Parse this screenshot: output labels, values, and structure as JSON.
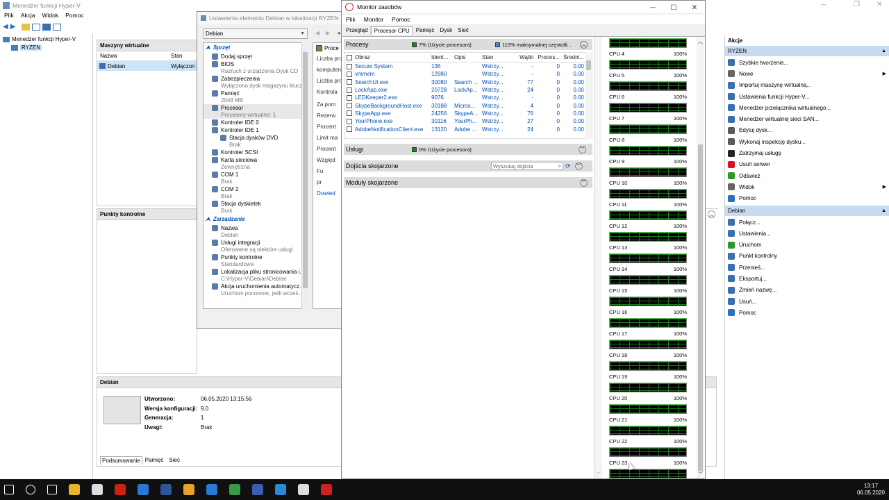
{
  "hyperv": {
    "title": "Menedżer funkcji Hyper-V",
    "menu": [
      "Plik",
      "Akcja",
      "Widok",
      "Pomoc"
    ],
    "tree_root": "Menedżer funkcji Hyper-V",
    "tree_host": "RYZEN",
    "vm_panel_title": "Maszyny wirtualne",
    "vm_cols": [
      "Nazwa",
      "Stan"
    ],
    "vm_rows": [
      {
        "name": "Debian",
        "state": "Wyłączon"
      }
    ],
    "checkpoints_title": "Punkty kontrolne",
    "details_title": "Debian",
    "details": [
      {
        "label": "Utworzono:",
        "value": "06.05.2020 13:15:56"
      },
      {
        "label": "Wersja konfiguracji:",
        "value": "9.0"
      },
      {
        "label": "Generacja:",
        "value": "1"
      },
      {
        "label": "Uwagi:",
        "value": "Brak"
      }
    ],
    "details_tabs": [
      "Podsumowanie",
      "Pamięć",
      "Sieć"
    ],
    "actions_title": "Akcje",
    "actions_host": "RYZEN",
    "host_actions": [
      "Szybkie tworzenie...",
      "Nowe",
      "Importuj maszynę wirtualną...",
      "Ustawienia funkcji Hyper-V...",
      "Menedżer przełącznika wirtualnego...",
      "Menedżer wirtualnej sieci SAN...",
      "Edytuj dysk...",
      "Wykonaj inspekcję dysku...",
      "Zatrzymaj usługę",
      "Usuń serwer",
      "Odśwież",
      "Widok",
      "Pomoc"
    ],
    "actions_vm": "Debian",
    "vm_actions": [
      "Połącz...",
      "Ustawienia...",
      "Uruchom",
      "Punkt kontrolny",
      "Przenieś...",
      "Eksportuj...",
      "Zmień nazwę...",
      "Usuń...",
      "Pomoc"
    ]
  },
  "settings": {
    "title": "Ustawienia elementu Debian w lokalizacji RYZEN",
    "vm_select": "Debian",
    "hw_header": "Sprzęt",
    "hw_items": [
      {
        "name": "Dodaj sprzęt",
        "sub": ""
      },
      {
        "name": "BIOS",
        "sub": "Rozruch z urządzenia Dysk CD"
      },
      {
        "name": "Zabezpieczenia",
        "sub": "Wyłączono dysk magazynu kluczy"
      },
      {
        "name": "Pamięć",
        "sub": "2048 MB"
      },
      {
        "name": "Procesor",
        "sub": "Procesory wirtualne: 1"
      },
      {
        "name": "Kontroler IDE 0",
        "sub": ""
      },
      {
        "name": "Kontroler IDE 1",
        "sub": ""
      },
      {
        "name": "Stacja dysków DVD",
        "sub": "Brak"
      },
      {
        "name": "Kontroler SCSI",
        "sub": ""
      },
      {
        "name": "Karta sieciowa",
        "sub": "Zewnętrzna"
      },
      {
        "name": "COM 1",
        "sub": "Brak"
      },
      {
        "name": "COM 2",
        "sub": "Brak"
      },
      {
        "name": "Stacja dyskietek",
        "sub": "Brak"
      }
    ],
    "mgmt_header": "Zarządzanie",
    "mgmt_items": [
      {
        "name": "Nazwa",
        "sub": "Debian"
      },
      {
        "name": "Usługi integracji",
        "sub": "Oferowane są niektóre usługi"
      },
      {
        "name": "Punkty kontrolne",
        "sub": "Standardowa"
      },
      {
        "name": "Lokalizacja pliku stronicowania i...",
        "sub": "C:\\Hyper-V\\Debian\\Debian"
      },
      {
        "name": "Akcja uruchomienia automatycz...",
        "sub": "Uruchom ponownie, jeśli wcześ..."
      }
    ],
    "right_title": "Proce",
    "right_lines": [
      "Liczba pro",
      "komputera",
      "Liczba pro",
      "Kontrola",
      "Za pom",
      "Rezerw",
      "Procent",
      "Limit ma",
      "Procent",
      "Względ",
      "Fu",
      "pr",
      "Dowied"
    ]
  },
  "resmon": {
    "title": "Monitor zasobów",
    "menu": [
      "Plik",
      "Monitor",
      "Pomoc"
    ],
    "tabs": [
      "Przegląd",
      "Procesor CPU",
      "Pamięć",
      "Dysk",
      "Sieć"
    ],
    "processes_title": "Procesy",
    "processes_usage": "7% (Użycie procesora)",
    "processes_freq": "110% maksymalnej częstotli...",
    "proc_cols": [
      "Obraz",
      "Ident...",
      "Opis",
      "Stan",
      "Wątki",
      "Proces...",
      "Średni..."
    ],
    "proc_rows": [
      [
        "Secure System",
        "136",
        "",
        "Wstrzy...",
        "-",
        "0",
        "0.00"
      ],
      [
        "vmmem",
        "12980",
        "",
        "Wstrzy...",
        "-",
        "0",
        "0.00"
      ],
      [
        "SearchUI.exe",
        "30080",
        "Search ...",
        "Wstrzy...",
        "77",
        "0",
        "0.00"
      ],
      [
        "LockApp.exe",
        "20728",
        "LockAp...",
        "Wstrzy...",
        "24",
        "0",
        "0.00"
      ],
      [
        "LEDKeeper2.exe",
        "9076",
        "",
        "Wstrzy...",
        "-",
        "0",
        "0.00"
      ],
      [
        "SkypeBackgroundHost.exe",
        "30188",
        "Micros...",
        "Wstrzy...",
        "4",
        "0",
        "0.00"
      ],
      [
        "SkypeApp.exe",
        "24256",
        "SkypeA...",
        "Wstrzy...",
        "76",
        "0",
        "0.00"
      ],
      [
        "YourPhone.exe",
        "30116",
        "YourPh...",
        "Wstrzy...",
        "27",
        "0",
        "0.00"
      ],
      [
        "AdobeNotificationClient.exe",
        "13120",
        "Adobe ...",
        "Wstrzy...",
        "24",
        "0",
        "0.00"
      ]
    ],
    "services_title": "Usługi",
    "services_usage": "0% (Użycie procesora)",
    "handles_title": "Dojścia skojarzone",
    "handles_search_placeholder": "Wyszukaj dojścia",
    "modules_title": "Moduły skojarzone",
    "cpus": [
      {
        "label": "CPU 4",
        "value": "100%"
      },
      {
        "label": "CPU 5",
        "value": "100%"
      },
      {
        "label": "CPU 6",
        "value": "100%"
      },
      {
        "label": "CPU 7",
        "value": "100%"
      },
      {
        "label": "CPU 8",
        "value": "100%"
      },
      {
        "label": "CPU 9",
        "value": "100%"
      },
      {
        "label": "CPU 10",
        "value": "100%"
      },
      {
        "label": "CPU 11",
        "value": "100%"
      },
      {
        "label": "CPU 12",
        "value": "100%"
      },
      {
        "label": "CPU 13",
        "value": "100%"
      },
      {
        "label": "CPU 14",
        "value": "100%"
      },
      {
        "label": "CPU 15",
        "value": "100%"
      },
      {
        "label": "CPU 16",
        "value": "100%"
      },
      {
        "label": "CPU 17",
        "value": "100%"
      },
      {
        "label": "CPU 18",
        "value": "100%"
      },
      {
        "label": "CPU 19",
        "value": "100%"
      },
      {
        "label": "CPU 20",
        "value": "100%"
      },
      {
        "label": "CPU 21",
        "value": "100%"
      },
      {
        "label": "CPU 22",
        "value": "100%"
      },
      {
        "label": "CPU 23",
        "value": "100%"
      }
    ]
  },
  "taskbar": {
    "time": "13:17",
    "date": "06.05.2020",
    "icons": [
      "windows-icon",
      "search-icon",
      "task-view-icon",
      "file-explorer-icon",
      "store-icon",
      "app-red-icon",
      "app-blue-icon",
      "app-doc-icon",
      "chrome-icon",
      "mail-icon",
      "app-green-icon",
      "app-tool-icon",
      "edge-icon",
      "app-gauge-icon",
      "resmon-icon"
    ],
    "colors": {
      "bg": "#101010",
      "accent": "#0078d7"
    }
  }
}
